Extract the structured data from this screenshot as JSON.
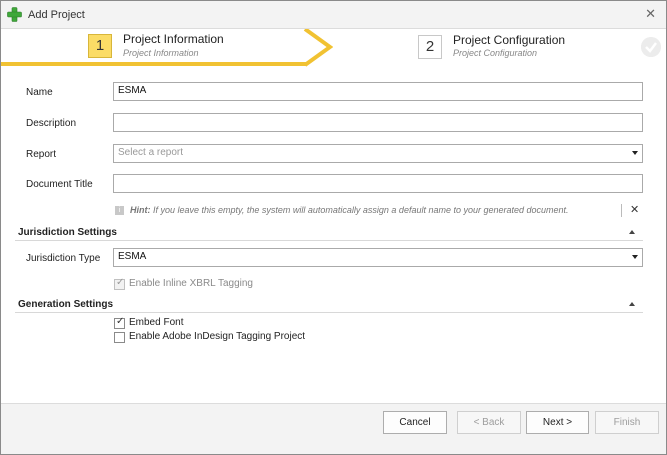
{
  "window": {
    "title": "Add Project"
  },
  "wizard": {
    "steps": [
      {
        "number": "1",
        "title": "Project Information",
        "subtitle": "Project Information"
      },
      {
        "number": "2",
        "title": "Project Configuration",
        "subtitle": "Project Configuration"
      }
    ]
  },
  "form": {
    "name_label": "Name",
    "name_value": "ESMA",
    "description_label": "Description",
    "description_value": "",
    "report_label": "Report",
    "report_placeholder": "Select a report",
    "document_title_label": "Document Title",
    "document_title_value": "",
    "hint_prefix": "Hint:",
    "hint_text": " If you leave this empty, the system will automatically assign a default name to your generated document."
  },
  "jurisdiction": {
    "section_title": "Jurisdiction Settings",
    "type_label": "Jurisdiction Type",
    "type_value": "ESMA",
    "inline_xbrl_label": "Enable Inline XBRL Tagging",
    "inline_xbrl_checked": true
  },
  "generation": {
    "section_title": "Generation Settings",
    "embed_font_label": "Embed Font",
    "embed_font_checked": true,
    "indesign_label": "Enable Adobe InDesign Tagging Project",
    "indesign_checked": false
  },
  "footer": {
    "cancel_label": "Cancel",
    "back_label": "< Back",
    "next_label": "Next >",
    "finish_label": "Finish"
  },
  "icons": {
    "app": "green-plus-icon",
    "close": "close-icon",
    "hint": "info-icon",
    "completed": "check-circle-icon"
  },
  "colors": {
    "active_step_fill": "#fbdc66",
    "active_step_underline": "#f1c232",
    "app_icon_green": "#3fa83a"
  }
}
